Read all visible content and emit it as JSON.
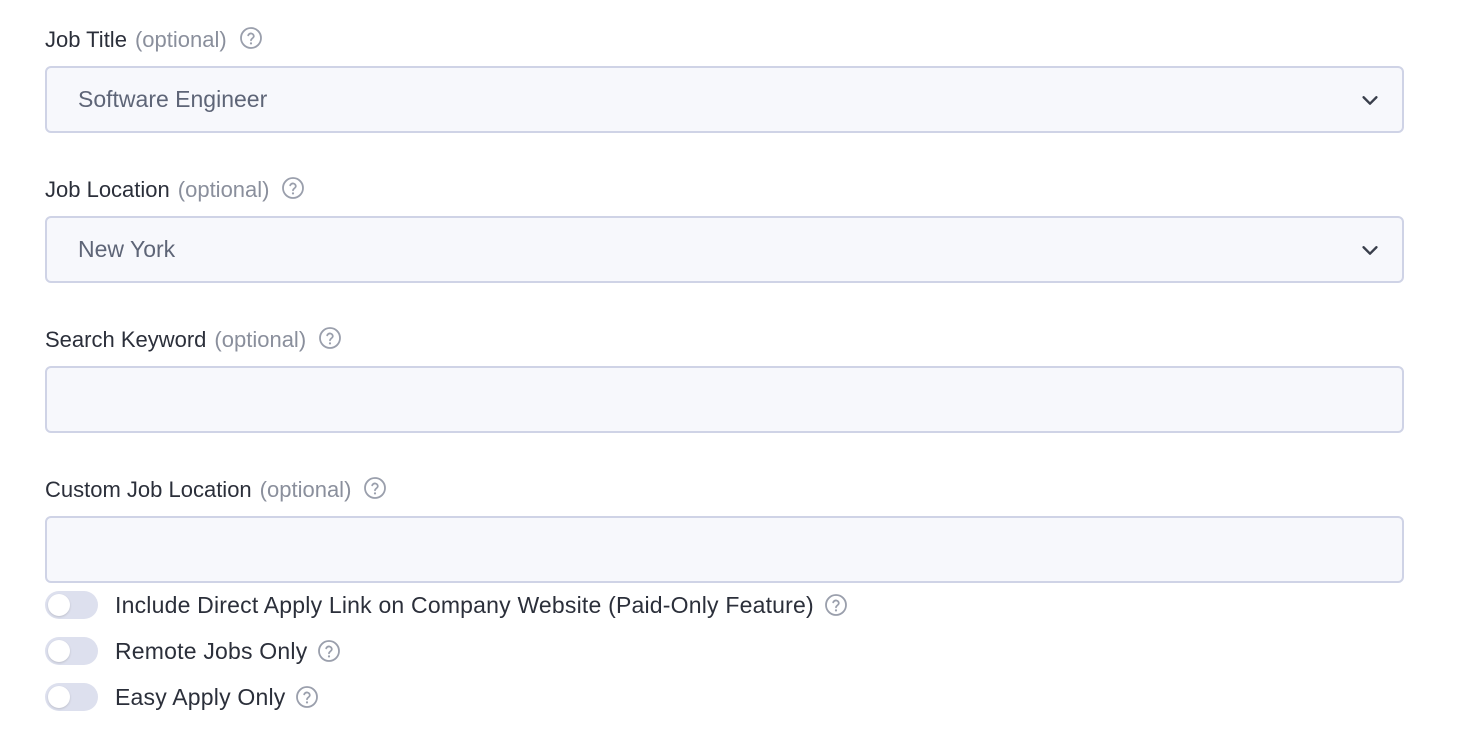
{
  "fields": [
    {
      "label": "Job Title",
      "optional": "(optional)",
      "type": "select",
      "value": "Software Engineer",
      "help_icon": "question-circle-icon"
    },
    {
      "label": "Job Location",
      "optional": "(optional)",
      "type": "select",
      "value": "New York",
      "help_icon": "question-circle-icon"
    },
    {
      "label": "Search Keyword",
      "optional": "(optional)",
      "type": "text",
      "value": "",
      "help_icon": "question-circle-icon"
    },
    {
      "label": "Custom Job Location",
      "optional": "(optional)",
      "type": "text",
      "value": "",
      "help_icon": "question-circle-icon"
    }
  ],
  "toggles": [
    {
      "label": "Include Direct Apply Link on Company Website (Paid-Only Feature)",
      "on": false
    },
    {
      "label": "Remote Jobs Only",
      "on": false
    },
    {
      "label": "Easy Apply Only",
      "on": false
    }
  ],
  "colors": {
    "input_border": "#cfd3e6",
    "input_bg": "#f7f8fc",
    "toggle_off": "#dde0ee",
    "muted_text": "#8a8f9c"
  }
}
